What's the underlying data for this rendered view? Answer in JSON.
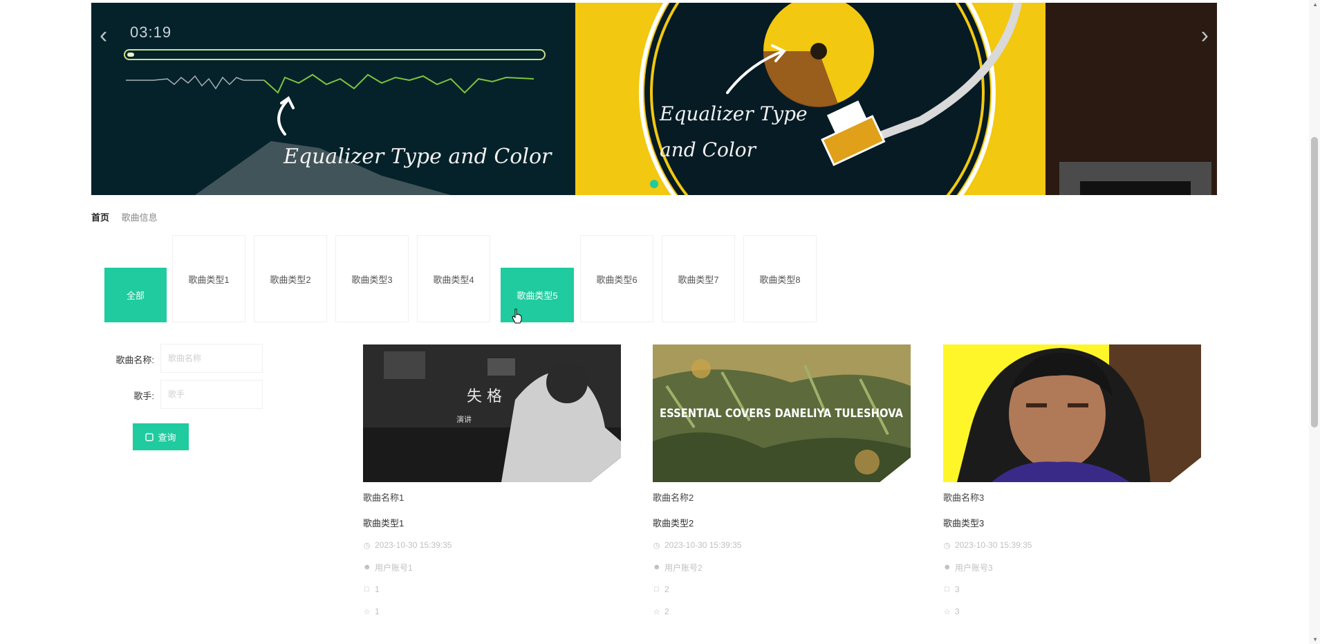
{
  "banner": {
    "time": "03:19",
    "caption_left": "Equalizer Type and Color",
    "caption_right_line1": "Equalizer Type",
    "caption_right_line2": "and Color",
    "prev_icon": "chevron-left-icon",
    "next_icon": "chevron-right-icon"
  },
  "breadcrumb": {
    "home": "首页",
    "current": "歌曲信息"
  },
  "tabs": [
    {
      "label": "全部"
    },
    {
      "label": "歌曲类型1"
    },
    {
      "label": "歌曲类型2"
    },
    {
      "label": "歌曲类型3"
    },
    {
      "label": "歌曲类型4"
    },
    {
      "label": "歌曲类型5"
    },
    {
      "label": "歌曲类型6"
    },
    {
      "label": "歌曲类型7"
    },
    {
      "label": "歌曲类型8"
    }
  ],
  "active_tab": "歌曲类型5",
  "filter": {
    "name_label": "歌曲名称:",
    "name_placeholder": "歌曲名称",
    "singer_label": "歌手:",
    "singer_placeholder": "歌手",
    "search_button": "查询"
  },
  "cards": [
    {
      "title": "歌曲名称1",
      "type": "歌曲类型1",
      "time": "2023-10-30 15:39:35",
      "user": "用户账号1",
      "comments": "1",
      "favorites": "1",
      "image_text_main": "失 格",
      "image_text_sub": "演讲"
    },
    {
      "title": "歌曲名称2",
      "type": "歌曲类型2",
      "time": "2023-10-30 15:39:35",
      "user": "用户账号2",
      "comments": "2",
      "favorites": "2",
      "image_text_main": "ESSENTIAL COVERS DANELIYA TULESHOVA"
    },
    {
      "title": "歌曲名称3",
      "type": "歌曲类型3",
      "time": "2023-10-30 15:39:35",
      "user": "用户账号3",
      "comments": "3",
      "favorites": "3"
    }
  ],
  "colors": {
    "accent": "#1fcb9f",
    "banner_bg": "#041a22",
    "banner_yellow": "#f2c811"
  }
}
